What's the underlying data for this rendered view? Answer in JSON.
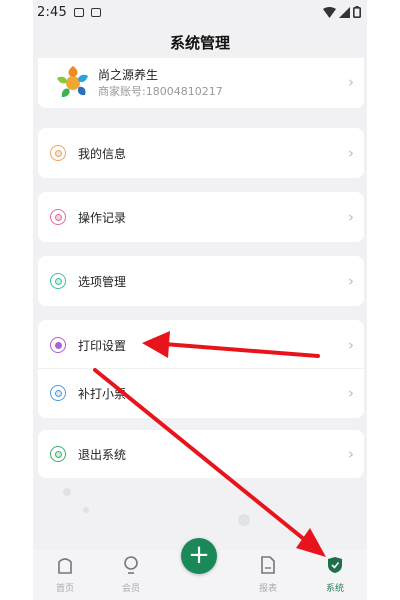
{
  "status_bar": {
    "time": "2:45"
  },
  "header": {
    "title": "系统管理"
  },
  "merchant": {
    "name": "尚之源养生",
    "account": "商家账号:18004810217"
  },
  "menu": {
    "items": [
      {
        "label": "我的信息",
        "icon": "user-circle-icon",
        "color": "#f0a35e"
      },
      {
        "label": "操作记录",
        "icon": "record-icon",
        "color": "#e36aa0"
      },
      {
        "label": "选项管理",
        "icon": "options-icon",
        "color": "#3fbfa8"
      },
      {
        "label": "打印设置",
        "icon": "print-icon",
        "color": "#b05ed6"
      },
      {
        "label": "补打小票",
        "icon": "receipt-icon",
        "color": "#4a9be0"
      },
      {
        "label": "退出系统",
        "icon": "logout-icon",
        "color": "#3ab067"
      }
    ],
    "chevron": "›"
  },
  "bottom_nav": {
    "items": [
      {
        "label": "首页",
        "icon": "home-icon"
      },
      {
        "label": "会员",
        "icon": "member-icon"
      },
      {
        "label": "报表",
        "icon": "report-icon"
      },
      {
        "label": "系统",
        "icon": "shield-icon",
        "active": true
      }
    ],
    "fab": "+"
  },
  "colors": {
    "accent": "#1a8858",
    "arrow": "#e8141c",
    "background": "#f1f1f3"
  }
}
